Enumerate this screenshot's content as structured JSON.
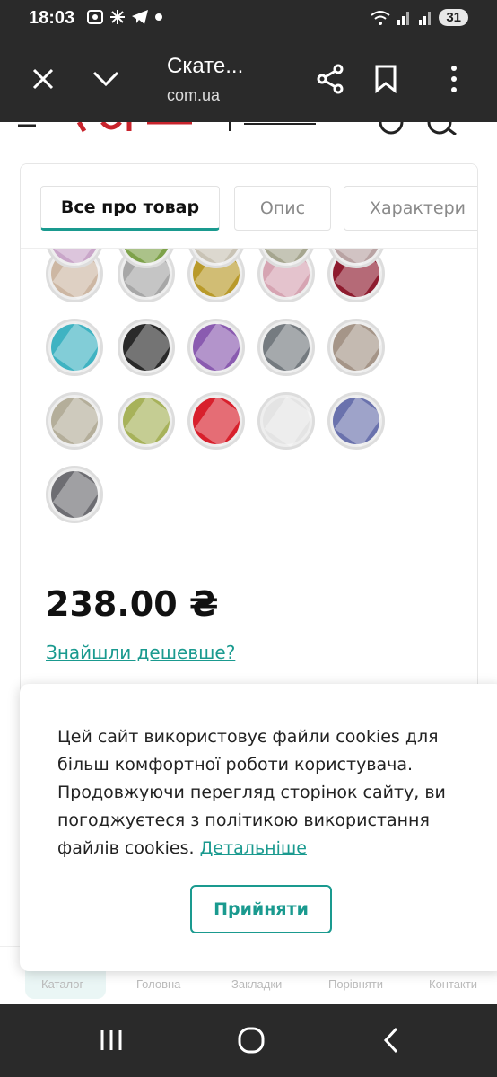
{
  "status_bar": {
    "time": "18:03",
    "battery": "31"
  },
  "browser": {
    "title": "Скате...",
    "url": "com.ua"
  },
  "tabs": [
    {
      "label": "Все про товар",
      "active": true
    },
    {
      "label": "Опис",
      "active": false
    },
    {
      "label": "Характери",
      "active": false
    }
  ],
  "swatch_colors": {
    "row_partial": [
      "#c9a6c9",
      "#7ea24a",
      "#c9c3b5",
      "#a6a68f",
      "#b9a3a3"
    ],
    "row1": [
      "#cdb7a3",
      "#a7a7a7",
      "#b99a2a",
      "#d6a4b2",
      "#8e1b2e"
    ],
    "row2": [
      "#3fb3c2",
      "#2a2a2a",
      "#8a5bb0",
      "#757b80",
      "#a59588"
    ],
    "row3": [
      "#b4ae9a",
      "#a7b25a",
      "#d8202c",
      "#e4e4e4",
      "#6a72ad"
    ],
    "row4": [
      "#6d6d72"
    ]
  },
  "product": {
    "price": "238.00 ₴",
    "cheaper_link": "Знайшли дешевше?"
  },
  "cookie": {
    "text": "Цей сайт використовує файли cookies для більш комфортної роботи користувача. Продовжуючи перегляд сторінок сайту, ви погоджуєтеся з політикою використання файлів cookies.",
    "link": "Детальніше",
    "accept_label": "Прийняти"
  },
  "bottom_nav": [
    "Каталог",
    "Головна",
    "Закладки",
    "Порівняти",
    "Контакти"
  ],
  "accent_color": "#1a9a8f"
}
